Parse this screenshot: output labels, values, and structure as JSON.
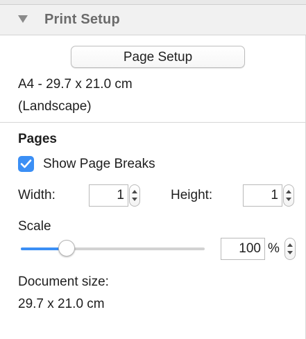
{
  "header": {
    "title": "Print Setup",
    "disclosure_icon": "disclosure-triangle-expanded"
  },
  "page_setup": {
    "button_label": "Page Setup",
    "paper_line": "A4 - 29.7 x 21.0 cm",
    "orientation_line": "(Landscape)"
  },
  "pages": {
    "section_title": "Pages",
    "show_page_breaks_label": "Show Page Breaks",
    "show_page_breaks_checked": true,
    "width_label": "Width:",
    "width_value": "1",
    "height_label": "Height:",
    "height_value": "1",
    "scale_label": "Scale",
    "scale_value": "100",
    "scale_unit": "%",
    "scale_slider_fraction": 0.25,
    "document_size_label": "Document size:",
    "document_size_value": "29.7 x 21.0 cm"
  },
  "colors": {
    "accent": "#3b8ff5",
    "header_bg": "#f1f1f1",
    "header_text": "#6b6b6b"
  }
}
